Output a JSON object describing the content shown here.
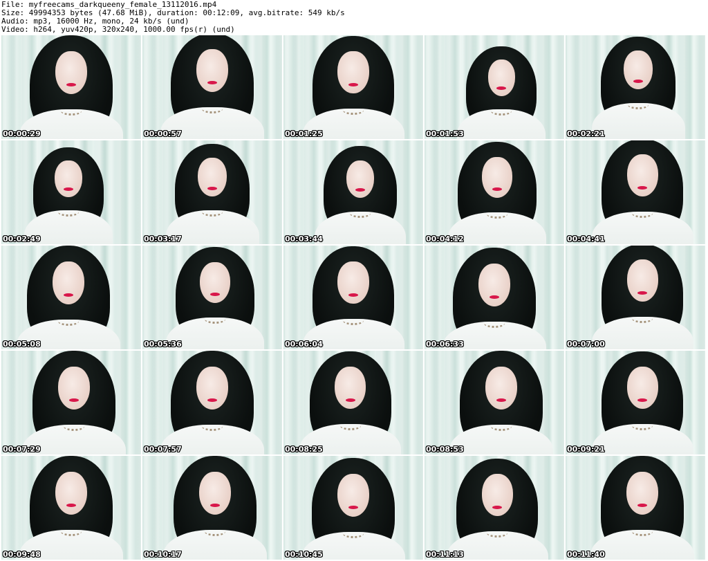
{
  "header": {
    "file_line": "File: myfreecams_darkqueeny_female_13112016.mp4",
    "size_line": "Size: 49994353 bytes (47.68 MiB), duration: 00:12:09, avg.bitrate: 549 kb/s",
    "audio_line": "Audio: mp3, 16000 Hz, mono, 24 kb/s (und)",
    "video_line": "Video: h264, yuv420p, 320x240, 1000.00 fps(r) (und)"
  },
  "thumbnails": [
    "00:00:29",
    "00:00:57",
    "00:01:25",
    "00:01:53",
    "00:02:21",
    "00:02:49",
    "00:03:17",
    "00:03:44",
    "00:04:12",
    "00:04:41",
    "00:05:08",
    "00:05:36",
    "00:06:04",
    "00:06:33",
    "00:07:00",
    "00:07:29",
    "00:07:57",
    "00:08:25",
    "00:08:53",
    "00:09:21",
    "00:09:48",
    "00:10:17",
    "00:10:45",
    "00:11:13",
    "00:11:40"
  ],
  "colors": {
    "page_background": "#ffffff",
    "wall": "#d9ebe6",
    "hair": "#0b0f0e",
    "shirt": "#f2f5f4",
    "lips": "#d8174a"
  }
}
